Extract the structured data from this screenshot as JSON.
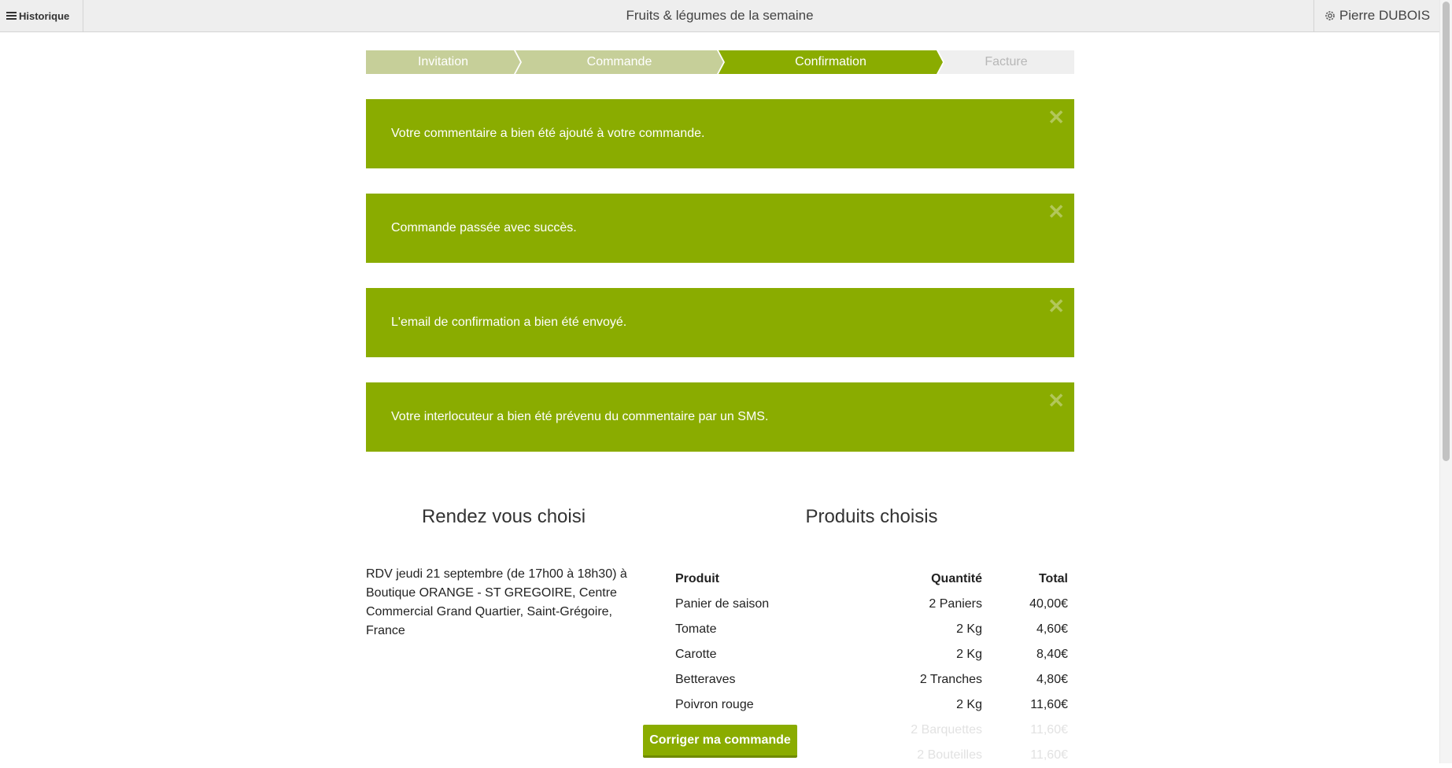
{
  "header": {
    "history_label": "Historique",
    "title": "Fruits & légumes de la semaine",
    "user_name": "Pierre DUBOIS"
  },
  "steps": [
    {
      "label": "Invitation",
      "state": "done"
    },
    {
      "label": "Commande",
      "state": "done"
    },
    {
      "label": "Confirmation",
      "state": "active"
    },
    {
      "label": "Facture",
      "state": "pending"
    }
  ],
  "alerts": [
    {
      "message": "Votre commentaire a bien été ajouté à votre commande."
    },
    {
      "message": "Commande passée avec succès."
    },
    {
      "message": "L'email de confirmation a bien été envoyé."
    },
    {
      "message": "Votre interlocuteur a bien été prévenu du commentaire par un SMS."
    }
  ],
  "rendezvous": {
    "heading": "Rendez vous choisi",
    "text": "RDV jeudi 21 septembre (de 17h00 à 18h30) à Boutique ORANGE - ST GREGOIRE, Centre Commercial Grand Quartier, Saint-Grégoire, France"
  },
  "products": {
    "heading": "Produits choisis",
    "columns": [
      "Produit",
      "Quantité",
      "Total"
    ],
    "rows": [
      {
        "product": "Panier de saison",
        "quantity": "2 Paniers",
        "total": "40,00€"
      },
      {
        "product": "Tomate",
        "quantity": "2 Kg",
        "total": "4,60€"
      },
      {
        "product": "Carotte",
        "quantity": "2 Kg",
        "total": "8,40€"
      },
      {
        "product": "Betteraves",
        "quantity": "2 Tranches",
        "total": "4,80€"
      },
      {
        "product": "Poivron rouge",
        "quantity": "2 Kg",
        "total": "11,60€"
      },
      {
        "product": "",
        "quantity": "2 Barquettes",
        "total": "11,60€"
      },
      {
        "product": "",
        "quantity": "2 Bouteilles",
        "total": "11,60€"
      }
    ]
  },
  "actions": {
    "fix_order_label": "Corriger ma commande"
  },
  "colors": {
    "accent": "#8aac00",
    "step_done": "#c6cf99",
    "step_pending": "#efefef"
  },
  "icons": {
    "menu": "hamburger-icon",
    "settings": "gear-icon",
    "close": "close-icon"
  }
}
